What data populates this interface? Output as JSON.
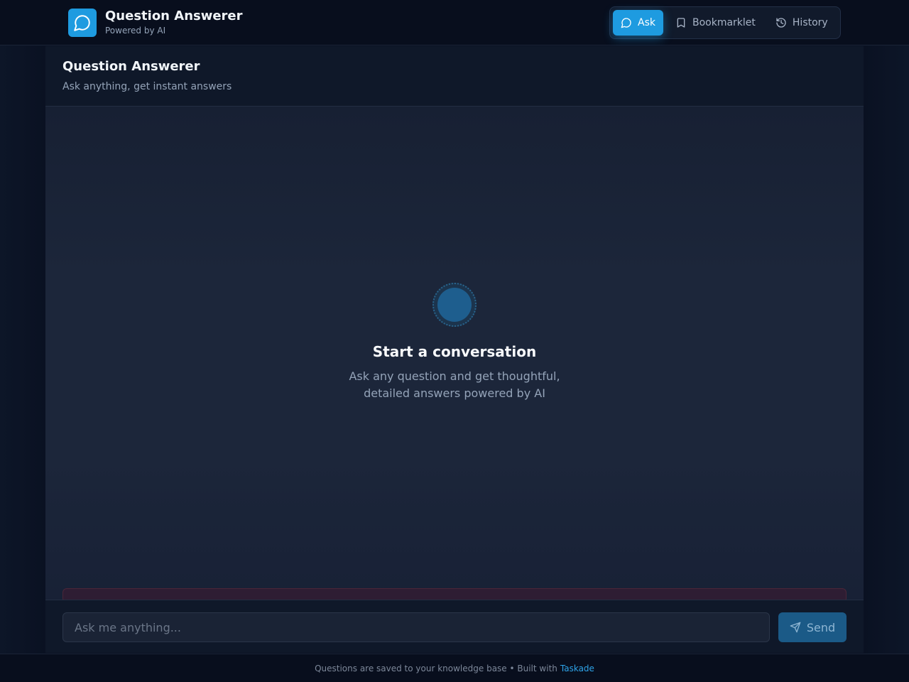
{
  "brand": {
    "title": "Question Answerer",
    "subtitle": "Powered by AI",
    "logo_icon": "chat-bubble-icon",
    "accent_color": "#1e9be0"
  },
  "nav": {
    "items": [
      {
        "label": "Ask",
        "icon": "chat-bubble-icon",
        "active": true
      },
      {
        "label": "Bookmarklet",
        "icon": "bookmark-icon",
        "active": false
      },
      {
        "label": "History",
        "icon": "history-icon",
        "active": false
      }
    ]
  },
  "panel": {
    "title": "Question Answerer",
    "subtitle": "Ask anything, get instant answers"
  },
  "empty_state": {
    "title": "Start a conversation",
    "description": "Ask any question and get thoughtful, detailed answers powered by AI"
  },
  "composer": {
    "placeholder": "Ask me anything...",
    "value": "",
    "send_label": "Send",
    "send_icon": "send-icon"
  },
  "footer": {
    "text": "Questions are saved to your knowledge base • Built with",
    "link_label": "Taskade"
  }
}
